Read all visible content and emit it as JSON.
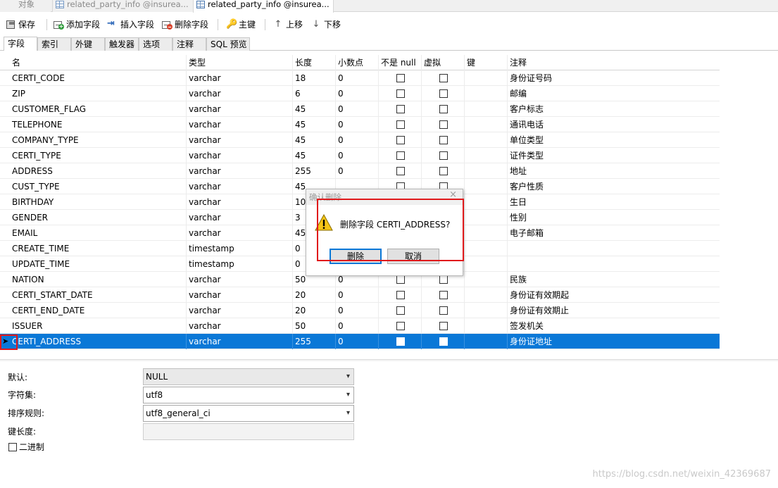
{
  "tabs": {
    "objects": "对象",
    "tab1": "related_party_info @insurea...",
    "tab2": "related_party_info @insurea..."
  },
  "toolbar": {
    "save": "保存",
    "add_field": "添加字段",
    "insert_field": "插入字段",
    "delete_field": "删除字段",
    "primary_key": "主键",
    "move_up": "上移",
    "move_down": "下移"
  },
  "subtabs": [
    "字段",
    "索引",
    "外键",
    "触发器",
    "选项",
    "注释",
    "SQL 预览"
  ],
  "grid": {
    "headers": {
      "name": "名",
      "type": "类型",
      "length": "长度",
      "decimals": "小数点",
      "not_null": "不是 null",
      "virtual": "虚拟",
      "key": "键",
      "comment": "注释"
    },
    "rows": [
      {
        "name": "CERTI_CODE",
        "type": "varchar",
        "length": "18",
        "decimals": "0",
        "comment": "身份证号码"
      },
      {
        "name": "ZIP",
        "type": "varchar",
        "length": "6",
        "decimals": "0",
        "comment": "邮编"
      },
      {
        "name": "CUSTOMER_FLAG",
        "type": "varchar",
        "length": "45",
        "decimals": "0",
        "comment": "客户标志"
      },
      {
        "name": "TELEPHONE",
        "type": "varchar",
        "length": "45",
        "decimals": "0",
        "comment": "通讯电话"
      },
      {
        "name": "COMPANY_TYPE",
        "type": "varchar",
        "length": "45",
        "decimals": "0",
        "comment": "单位类型"
      },
      {
        "name": "CERTI_TYPE",
        "type": "varchar",
        "length": "45",
        "decimals": "0",
        "comment": "证件类型"
      },
      {
        "name": "ADDRESS",
        "type": "varchar",
        "length": "255",
        "decimals": "0",
        "comment": "地址"
      },
      {
        "name": "CUST_TYPE",
        "type": "varchar",
        "length": "45",
        "decimals": "",
        "comment": "客户性质"
      },
      {
        "name": "BIRTHDAY",
        "type": "varchar",
        "length": "10",
        "decimals": "",
        "comment": "生日"
      },
      {
        "name": "GENDER",
        "type": "varchar",
        "length": "3",
        "decimals": "",
        "comment": "性别"
      },
      {
        "name": "EMAIL",
        "type": "varchar",
        "length": "45",
        "decimals": "",
        "comment": "电子邮箱"
      },
      {
        "name": "CREATE_TIME",
        "type": "timestamp",
        "length": "0",
        "decimals": "",
        "comment": ""
      },
      {
        "name": "UPDATE_TIME",
        "type": "timestamp",
        "length": "0",
        "decimals": "",
        "comment": ""
      },
      {
        "name": "NATION",
        "type": "varchar",
        "length": "50",
        "decimals": "0",
        "comment": "民族"
      },
      {
        "name": "CERTI_START_DATE",
        "type": "varchar",
        "length": "20",
        "decimals": "0",
        "comment": "身份证有效期起"
      },
      {
        "name": "CERTI_END_DATE",
        "type": "varchar",
        "length": "20",
        "decimals": "0",
        "comment": "身份证有效期止"
      },
      {
        "name": "ISSUER",
        "type": "varchar",
        "length": "50",
        "decimals": "0",
        "comment": "签发机关"
      },
      {
        "name": "CERTI_ADDRESS",
        "type": "varchar",
        "length": "255",
        "decimals": "0",
        "comment": "身份证地址"
      }
    ]
  },
  "properties": {
    "default_label": "默认:",
    "default_value": "NULL",
    "charset_label": "字符集:",
    "charset_value": "utf8",
    "collation_label": "排序规则:",
    "collation_value": "utf8_general_ci",
    "key_length_label": "键长度:",
    "binary_label": "二进制"
  },
  "dialog": {
    "title": "确认删除",
    "close": "×",
    "message": "删除字段 CERTI_ADDRESS?",
    "delete": "删除",
    "cancel": "取消"
  },
  "watermark": "https://blog.csdn.net/weixin_42369687",
  "colors": {
    "selection": "#0a78d7",
    "highlight_box": "#e0191b"
  }
}
